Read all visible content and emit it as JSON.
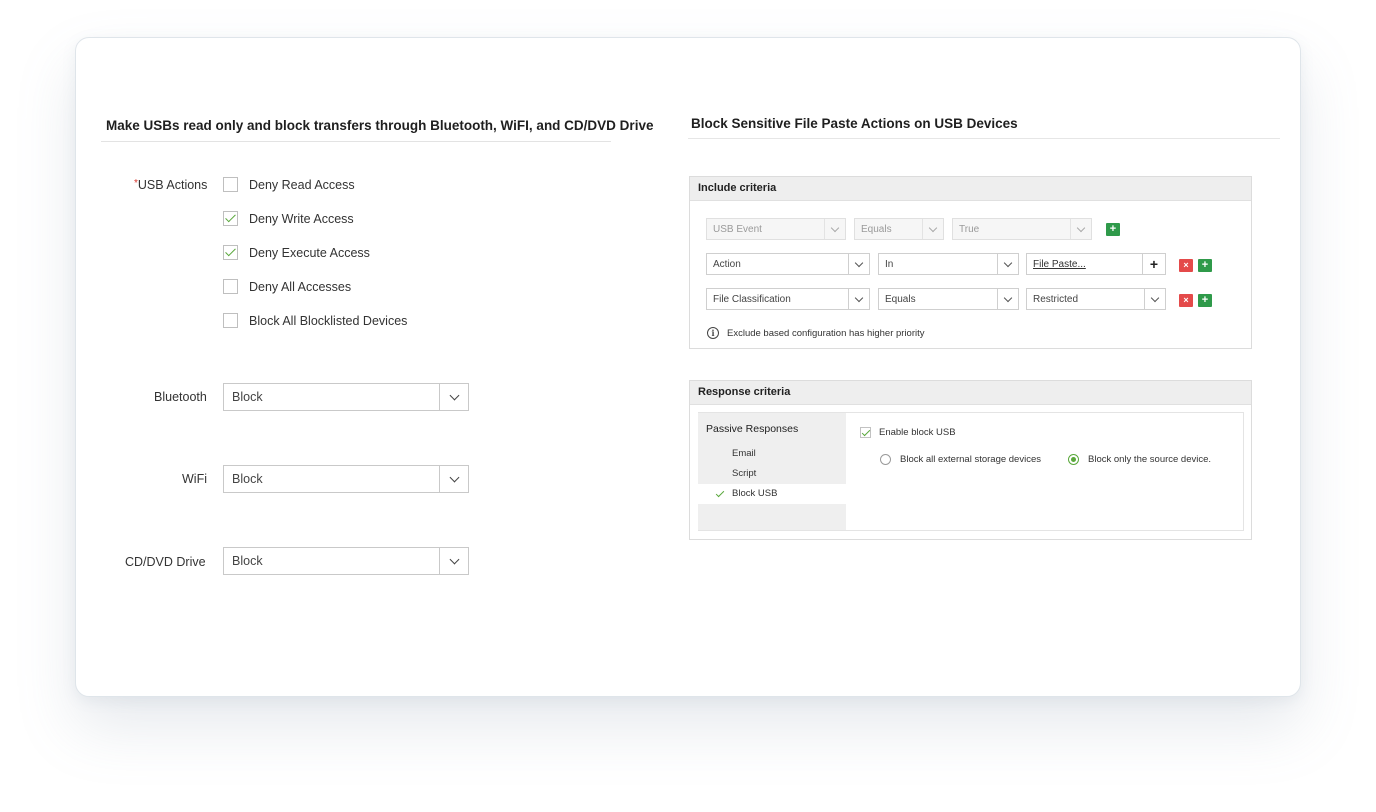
{
  "left": {
    "title": "Make USBs read only and block transfers through Bluetooth, WiFI, and CD/DVD Drive",
    "usb_actions": {
      "required_mark": "*",
      "label": "USB Actions",
      "options": [
        {
          "label": "Deny Read Access",
          "checked": false
        },
        {
          "label": "Deny Write Access",
          "checked": true
        },
        {
          "label": "Deny Execute Access",
          "checked": true
        },
        {
          "label": "Deny All Accesses",
          "checked": false
        },
        {
          "label": "Block All Blocklisted Devices",
          "checked": false
        }
      ]
    },
    "bluetooth": {
      "label": "Bluetooth",
      "value": "Block"
    },
    "wifi": {
      "label": "WiFi",
      "value": "Block"
    },
    "cd_dvd": {
      "label": "CD/DVD Drive",
      "value": "Block"
    }
  },
  "right": {
    "title": "Block Sensitive File Paste Actions on USB Devices",
    "include": {
      "header": "Include criteria",
      "rows": [
        {
          "field": "USB Event",
          "operator": "Equals",
          "value": "True",
          "disabled": true
        },
        {
          "field": "Action",
          "operator": "In",
          "value": "File Paste...",
          "disabled": false
        },
        {
          "field": "File Classification",
          "operator": "Equals",
          "value": "Restricted",
          "disabled": false
        }
      ],
      "plus_symbol": "+",
      "remove_symbol": "×",
      "info_symbol": "i",
      "note": "Exclude based configuration has higher priority"
    },
    "response": {
      "header": "Response criteria",
      "sidebar_title": "Passive Responses",
      "items": [
        "Email",
        "Script",
        "Block USB"
      ],
      "active_item": "Block USB",
      "enable_label": "Enable block USB",
      "enable_checked": true,
      "radio_options": [
        {
          "label": "Block all external storage devices",
          "selected": false
        },
        {
          "label": "Block only the source device.",
          "selected": true
        }
      ]
    }
  },
  "colors": {
    "accent_green": "#2f9a4a",
    "check_green": "#5aa83c",
    "remove_red": "#e44a4a",
    "required_red": "#d9342b"
  }
}
